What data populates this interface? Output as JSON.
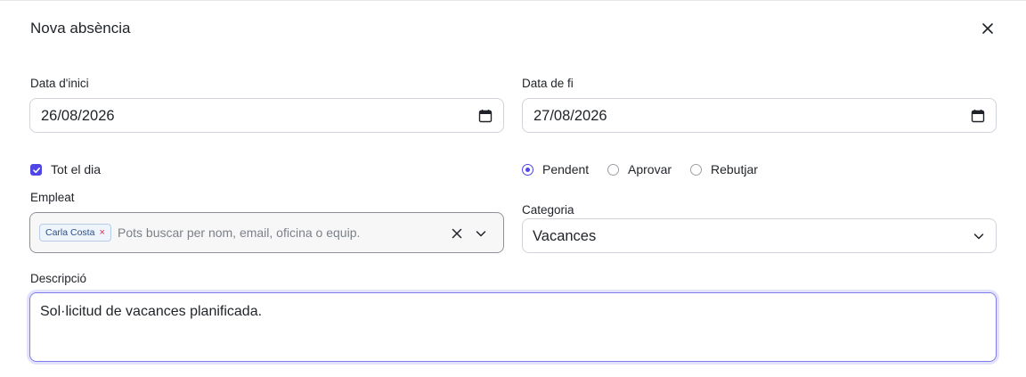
{
  "modal": {
    "title": "Nova absència"
  },
  "start_date": {
    "label": "Data d'inici",
    "value": "26/08/2026"
  },
  "end_date": {
    "label": "Data de fi",
    "value": "27/08/2026"
  },
  "all_day": {
    "label": "Tot el dia",
    "checked": true
  },
  "status": {
    "options": [
      "Pendent",
      "Aprovar",
      "Rebutjar"
    ],
    "selected": "Pendent"
  },
  "employee": {
    "label": "Empleat",
    "selected_chip": "Carla Costa",
    "placeholder": "Pots buscar per nom, email, oficina o equip."
  },
  "category": {
    "label": "Categoria",
    "value": "Vacances"
  },
  "description": {
    "label": "Descripció",
    "value": "Sol·licitud de vacances planificada."
  },
  "colors": {
    "accent": "#4f46e5",
    "focus_border": "#7f7cf0",
    "chip_bg": "#eef4fc",
    "chip_remove": "#e0245e"
  }
}
